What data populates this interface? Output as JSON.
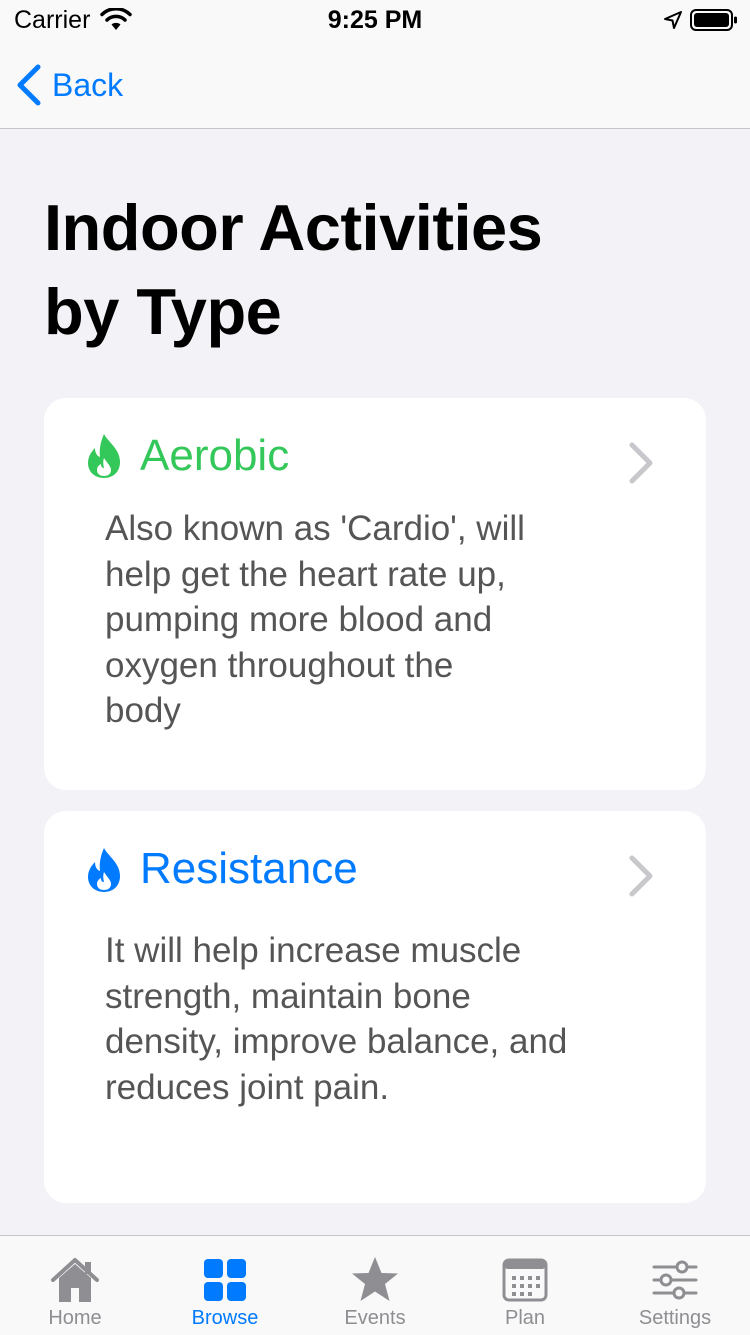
{
  "status_bar": {
    "carrier": "Carrier",
    "time": "9:25 PM"
  },
  "nav": {
    "back_label": "Back"
  },
  "page": {
    "title_line1": "Indoor Activities",
    "title_line2": "by Type"
  },
  "cards": [
    {
      "title": "Aerobic",
      "color": "#34c759",
      "icon": "flame-icon",
      "description_lines": [
        "Also known as 'Cardio', will",
        "help get the heart rate up,",
        "pumping more blood and",
        "oxygen throughout the",
        "body"
      ]
    },
    {
      "title": "Resistance",
      "color": "#007aff",
      "icon": "flame-icon",
      "description_lines": [
        "It will help increase muscle",
        "strength, maintain bone",
        "density, improve balance, and",
        "reduces joint pain."
      ]
    }
  ],
  "tabs": [
    {
      "label": "Home",
      "icon": "house-icon",
      "active": false
    },
    {
      "label": "Browse",
      "icon": "grid-icon",
      "active": true
    },
    {
      "label": "Events",
      "icon": "star-icon",
      "active": false
    },
    {
      "label": "Plan",
      "icon": "calendar-icon",
      "active": false
    },
    {
      "label": "Settings",
      "icon": "sliders-icon",
      "active": false
    }
  ],
  "colors": {
    "accent": "#007aff",
    "aerobic": "#34c759",
    "inactive": "#8e8e93"
  }
}
